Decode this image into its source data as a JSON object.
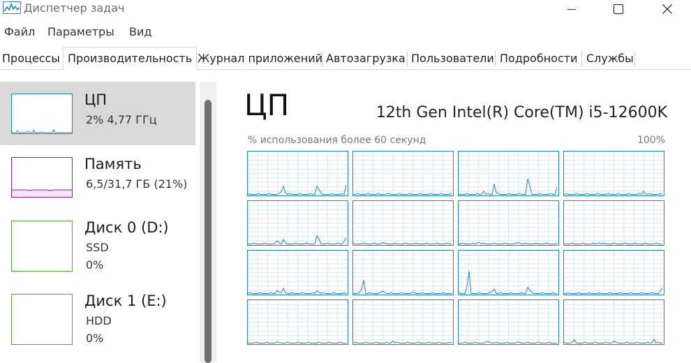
{
  "window": {
    "title": "Диспетчер задач",
    "controls": [
      "minimize-icon",
      "maximize-icon",
      "close-icon"
    ]
  },
  "menu": [
    "Файл",
    "Параметры",
    "Вид"
  ],
  "tabs": [
    {
      "label": "Процессы",
      "active": false
    },
    {
      "label": "Производительность",
      "active": true
    },
    {
      "label": "Журнал приложений",
      "active": false
    },
    {
      "label": "Автозагрузка",
      "active": false
    },
    {
      "label": "Пользователи",
      "active": false
    },
    {
      "label": "Подробности",
      "active": false
    },
    {
      "label": "Службы",
      "active": false
    }
  ],
  "sidebar": {
    "items": [
      {
        "name": "ЦП",
        "line1": "2%  4,77 ГГц",
        "line2": "",
        "color": "#1c85c6",
        "active": true
      },
      {
        "name": "Память",
        "line1": "6,5/31,7 ГБ (21%)",
        "line2": "",
        "color": "#8b1ba6",
        "active": false
      },
      {
        "name": "Диск 0 (D:)",
        "line1": "SSD",
        "line2": "0%",
        "color": "#4da832",
        "active": false
      },
      {
        "name": "Диск 1 (E:)",
        "line1": "HDD",
        "line2": "0%",
        "color": "#4da832",
        "active": false
      }
    ]
  },
  "main": {
    "title": "ЦП",
    "cpu_model": "12th Gen Intel(R) Core(TM) i5-12600K",
    "graph_caption": "% использования более 60 секунд",
    "graph_max": "100%",
    "core_graphs": {
      "count": 16,
      "columns": 4,
      "line_color": "#1c85c6",
      "grid_color": "#d6e8f4"
    }
  }
}
